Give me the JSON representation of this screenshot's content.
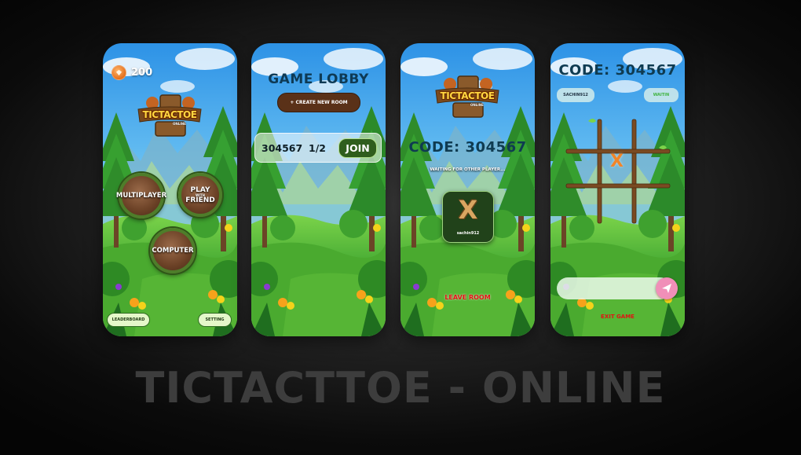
{
  "footer_title": "TICTACTTOE - ONLINE",
  "colors": {
    "background": "#111111",
    "sky": "#3aa3ec",
    "grass": "#3ba22f",
    "title_blue": "#0f3b51",
    "leave_red": "#e01414",
    "join_green": "#2f5e1d"
  },
  "screen1": {
    "coins": "200",
    "logo_text": "TICTACTOE",
    "logo_sub": "ONLINE",
    "buttons": {
      "multiplayer": "MULTIPLAYER",
      "play": "PLAY",
      "with": "WITH",
      "friend": "FRIEND",
      "computer": "COMPUTER",
      "leaderboard": "LEADERBOARD",
      "setting": "SETTING"
    },
    "icons": [
      "coin-icon",
      "logo-icon"
    ]
  },
  "screen2": {
    "title": "GAME LOBBY",
    "create_room": "+ CREATE NEW ROOM",
    "room": {
      "code": "304567",
      "players": "1/2",
      "join": "JOIN"
    }
  },
  "screen3": {
    "logo_text": "TICTACTOE",
    "logo_sub": "ONLINE",
    "code": "CODE: 304567",
    "waiting": "WAITING FOR OTHER PLAYER...",
    "player": {
      "mark": "X",
      "name": "sachin912"
    },
    "leave": "LEAVE ROOM"
  },
  "screen4": {
    "code": "CODE: 304567",
    "player1": "SACHIN912",
    "player2": "WAITIN",
    "board": [
      "",
      "",
      "",
      "",
      "X",
      "",
      "",
      "",
      ""
    ],
    "exit": "EXIT GAME"
  }
}
